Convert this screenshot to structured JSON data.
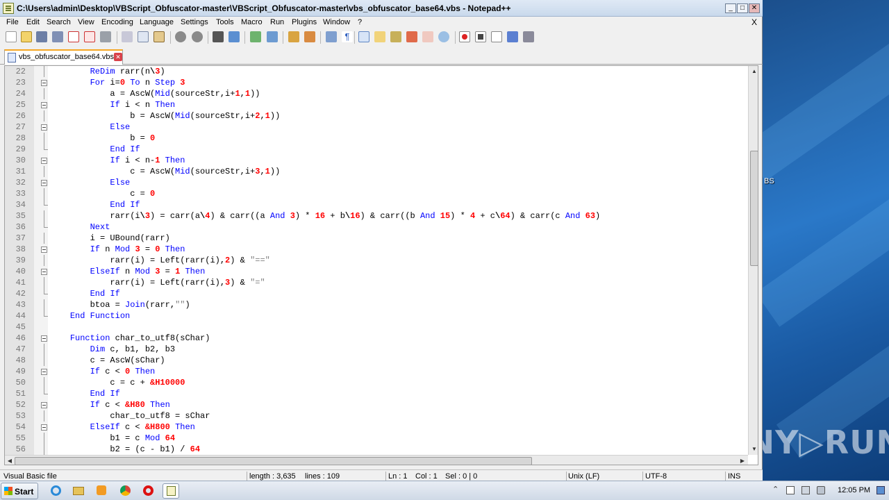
{
  "window": {
    "title": "C:\\Users\\admin\\Desktop\\VBScript_Obfuscator-master\\VBScript_Obfuscator-master\\vbs_obfuscator_base64.vbs - Notepad++",
    "minimize": "_",
    "maximize": "□",
    "close": "✕"
  },
  "menu": {
    "items": [
      "File",
      "Edit",
      "Search",
      "View",
      "Encoding",
      "Language",
      "Settings",
      "Tools",
      "Macro",
      "Run",
      "Plugins",
      "Window",
      "?"
    ],
    "close_doc": "X"
  },
  "toolbar": {
    "icons": [
      "new-icon",
      "open-icon",
      "save-icon",
      "save-all-icon",
      "close-icon",
      "close-all-icon",
      "print-icon",
      "cut-icon",
      "copy-icon",
      "paste-icon",
      "undo-icon",
      "redo-icon",
      "find-icon",
      "replace-icon",
      "zoom-in-icon",
      "zoom-out-icon",
      "sync-vertical-icon",
      "sync-horizontal-icon",
      "word-wrap-icon",
      "show-all-chars-icon",
      "indent-guide-icon",
      "user-lang-icon",
      "doc-map-icon",
      "function-list-icon",
      "folder-workspace-icon",
      "monitoring-icon",
      "record-macro-icon",
      "stop-macro-icon",
      "play-macro-icon",
      "run-macro-multiple-icon",
      "save-macro-icon"
    ]
  },
  "tab": {
    "label": "vbs_obfuscator_base64.vbs",
    "close": "✕"
  },
  "editor": {
    "lines": [
      {
        "n": "22",
        "fold": "line",
        "t": [
          [
            "",
            "        "
          ],
          [
            "k",
            "ReDim"
          ],
          [
            "",
            " rarr(n"
          ],
          [
            "o",
            "\\"
          ],
          [
            "n",
            "3"
          ],
          [
            "",
            ")"
          ]
        ]
      },
      {
        "n": "23",
        "fold": "box",
        "t": [
          [
            "",
            "        "
          ],
          [
            "k",
            "For"
          ],
          [
            "",
            " i="
          ],
          [
            "n",
            "0"
          ],
          [
            "",
            " "
          ],
          [
            "k",
            "To"
          ],
          [
            "",
            " n "
          ],
          [
            "k",
            "Step"
          ],
          [
            "",
            " "
          ],
          [
            "n",
            "3"
          ]
        ]
      },
      {
        "n": "24",
        "fold": "line",
        "t": [
          [
            "",
            "            a = AscW("
          ],
          [
            "k",
            "Mid"
          ],
          [
            "",
            "(sourceStr,i+"
          ],
          [
            "n",
            "1"
          ],
          [
            "",
            ","
          ],
          [
            "n",
            "1"
          ],
          [
            "",
            "))"
          ]
        ]
      },
      {
        "n": "25",
        "fold": "box",
        "t": [
          [
            "",
            "            "
          ],
          [
            "k",
            "If"
          ],
          [
            "",
            " i < n "
          ],
          [
            "k",
            "Then"
          ]
        ]
      },
      {
        "n": "26",
        "fold": "line",
        "t": [
          [
            "",
            "                b = AscW("
          ],
          [
            "k",
            "Mid"
          ],
          [
            "",
            "(sourceStr,i+"
          ],
          [
            "n",
            "2"
          ],
          [
            "",
            ","
          ],
          [
            "n",
            "1"
          ],
          [
            "",
            "))"
          ]
        ]
      },
      {
        "n": "27",
        "fold": "box",
        "t": [
          [
            "",
            "            "
          ],
          [
            "k",
            "Else"
          ]
        ]
      },
      {
        "n": "28",
        "fold": "line",
        "t": [
          [
            "",
            "                b = "
          ],
          [
            "n",
            "0"
          ]
        ]
      },
      {
        "n": "29",
        "fold": "end",
        "t": [
          [
            "",
            "            "
          ],
          [
            "k",
            "End If"
          ]
        ]
      },
      {
        "n": "30",
        "fold": "box",
        "t": [
          [
            "",
            "            "
          ],
          [
            "k",
            "If"
          ],
          [
            "",
            " i < n-"
          ],
          [
            "n",
            "1"
          ],
          [
            "",
            " "
          ],
          [
            "k",
            "Then"
          ]
        ]
      },
      {
        "n": "31",
        "fold": "line",
        "t": [
          [
            "",
            "                c = AscW("
          ],
          [
            "k",
            "Mid"
          ],
          [
            "",
            "(sourceStr,i+"
          ],
          [
            "n",
            "3"
          ],
          [
            "",
            ","
          ],
          [
            "n",
            "1"
          ],
          [
            "",
            "))"
          ]
        ]
      },
      {
        "n": "32",
        "fold": "box",
        "t": [
          [
            "",
            "            "
          ],
          [
            "k",
            "Else"
          ]
        ]
      },
      {
        "n": "33",
        "fold": "line",
        "t": [
          [
            "",
            "                c = "
          ],
          [
            "n",
            "0"
          ]
        ]
      },
      {
        "n": "34",
        "fold": "end",
        "t": [
          [
            "",
            "            "
          ],
          [
            "k",
            "End If"
          ]
        ]
      },
      {
        "n": "35",
        "fold": "line",
        "t": [
          [
            "",
            "            rarr(i"
          ],
          [
            "o",
            "\\"
          ],
          [
            "n",
            "3"
          ],
          [
            "",
            ") = carr(a"
          ],
          [
            "o",
            "\\"
          ],
          [
            "n",
            "4"
          ],
          [
            "",
            ") & carr((a "
          ],
          [
            "k",
            "And"
          ],
          [
            "",
            " "
          ],
          [
            "n",
            "3"
          ],
          [
            "",
            ") * "
          ],
          [
            "n",
            "16"
          ],
          [
            "",
            " + b"
          ],
          [
            "o",
            "\\"
          ],
          [
            "n",
            "16"
          ],
          [
            "",
            ") & carr((b "
          ],
          [
            "k",
            "And"
          ],
          [
            "",
            " "
          ],
          [
            "n",
            "15"
          ],
          [
            "",
            ") * "
          ],
          [
            "n",
            "4"
          ],
          [
            "",
            " + c"
          ],
          [
            "o",
            "\\"
          ],
          [
            "n",
            "64"
          ],
          [
            "",
            ") & carr(c "
          ],
          [
            "k",
            "And"
          ],
          [
            "",
            " "
          ],
          [
            "n",
            "63"
          ],
          [
            "",
            ")"
          ]
        ]
      },
      {
        "n": "36",
        "fold": "end",
        "t": [
          [
            "",
            "        "
          ],
          [
            "k",
            "Next"
          ]
        ]
      },
      {
        "n": "37",
        "fold": "line",
        "t": [
          [
            "",
            "        i = UBound(rarr)"
          ]
        ]
      },
      {
        "n": "38",
        "fold": "box",
        "t": [
          [
            "",
            "        "
          ],
          [
            "k",
            "If"
          ],
          [
            "",
            " n "
          ],
          [
            "k",
            "Mod"
          ],
          [
            "",
            " "
          ],
          [
            "n",
            "3"
          ],
          [
            "",
            " = "
          ],
          [
            "n",
            "0"
          ],
          [
            "",
            " "
          ],
          [
            "k",
            "Then"
          ]
        ]
      },
      {
        "n": "39",
        "fold": "line",
        "t": [
          [
            "",
            "            rarr(i) = Left(rarr(i),"
          ],
          [
            "n",
            "2"
          ],
          [
            "",
            ") & "
          ],
          [
            "s",
            "\"==\""
          ]
        ]
      },
      {
        "n": "40",
        "fold": "box",
        "t": [
          [
            "",
            "        "
          ],
          [
            "k",
            "ElseIf"
          ],
          [
            "",
            " n "
          ],
          [
            "k",
            "Mod"
          ],
          [
            "",
            " "
          ],
          [
            "n",
            "3"
          ],
          [
            "",
            " = "
          ],
          [
            "n",
            "1"
          ],
          [
            "",
            " "
          ],
          [
            "k",
            "Then"
          ]
        ]
      },
      {
        "n": "41",
        "fold": "line",
        "t": [
          [
            "",
            "            rarr(i) = Left(rarr(i),"
          ],
          [
            "n",
            "3"
          ],
          [
            "",
            ") & "
          ],
          [
            "s",
            "\"=\""
          ]
        ]
      },
      {
        "n": "42",
        "fold": "end",
        "t": [
          [
            "",
            "        "
          ],
          [
            "k",
            "End If"
          ]
        ]
      },
      {
        "n": "43",
        "fold": "line",
        "t": [
          [
            "",
            "        btoa = "
          ],
          [
            "k",
            "Join"
          ],
          [
            "",
            "(rarr,"
          ],
          [
            "s",
            "\"\""
          ],
          [
            "",
            ")"
          ]
        ]
      },
      {
        "n": "44",
        "fold": "end",
        "t": [
          [
            "",
            "    "
          ],
          [
            "k",
            "End Function"
          ]
        ]
      },
      {
        "n": "45",
        "fold": "",
        "t": [
          [
            "",
            ""
          ]
        ]
      },
      {
        "n": "46",
        "fold": "box",
        "t": [
          [
            "",
            "    "
          ],
          [
            "k",
            "Function"
          ],
          [
            "",
            " char_to_utf8(sChar)"
          ]
        ]
      },
      {
        "n": "47",
        "fold": "line",
        "t": [
          [
            "",
            "        "
          ],
          [
            "k",
            "Dim"
          ],
          [
            "",
            " c, b1, b2, b3"
          ]
        ]
      },
      {
        "n": "48",
        "fold": "line",
        "t": [
          [
            "",
            "        c = AscW(sChar)"
          ]
        ]
      },
      {
        "n": "49",
        "fold": "box",
        "t": [
          [
            "",
            "        "
          ],
          [
            "k",
            "If"
          ],
          [
            "",
            " c < "
          ],
          [
            "n",
            "0"
          ],
          [
            "",
            " "
          ],
          [
            "k",
            "Then"
          ]
        ]
      },
      {
        "n": "50",
        "fold": "line",
        "t": [
          [
            "",
            "            c = c + "
          ],
          [
            "n",
            "&H10000"
          ]
        ]
      },
      {
        "n": "51",
        "fold": "end",
        "t": [
          [
            "",
            "        "
          ],
          [
            "k",
            "End If"
          ]
        ]
      },
      {
        "n": "52",
        "fold": "box",
        "t": [
          [
            "",
            "        "
          ],
          [
            "k",
            "If"
          ],
          [
            "",
            " c < "
          ],
          [
            "n",
            "&H80"
          ],
          [
            "",
            " "
          ],
          [
            "k",
            "Then"
          ]
        ]
      },
      {
        "n": "53",
        "fold": "line",
        "t": [
          [
            "",
            "            char_to_utf8 = sChar"
          ]
        ]
      },
      {
        "n": "54",
        "fold": "box",
        "t": [
          [
            "",
            "        "
          ],
          [
            "k",
            "ElseIf"
          ],
          [
            "",
            " c < "
          ],
          [
            "n",
            "&H800"
          ],
          [
            "",
            " "
          ],
          [
            "k",
            "Then"
          ]
        ]
      },
      {
        "n": "55",
        "fold": "line",
        "t": [
          [
            "",
            "            b1 = c "
          ],
          [
            "k",
            "Mod"
          ],
          [
            "",
            " "
          ],
          [
            "n",
            "64"
          ]
        ]
      },
      {
        "n": "56",
        "fold": "line",
        "t": [
          [
            "",
            "            b2 = (c - b1) / "
          ],
          [
            "n",
            "64"
          ]
        ]
      }
    ]
  },
  "status": {
    "file_type": "Visual Basic file",
    "length": "length : 3,635",
    "lines": "lines : 109",
    "ln": "Ln : 1",
    "col": "Col : 1",
    "sel": "Sel : 0 | 0",
    "eol": "Unix (LF)",
    "encoding": "UTF-8",
    "mode": "INS"
  },
  "desktop": {
    "label": "BS",
    "watermark": "ANY▷RUN"
  },
  "taskbar": {
    "start": "Start",
    "apps": [
      "ie-icon",
      "explorer-icon",
      "media-player-icon",
      "chrome-icon",
      "opera-icon",
      "notepadpp-icon"
    ],
    "clock": "12:05 PM"
  }
}
